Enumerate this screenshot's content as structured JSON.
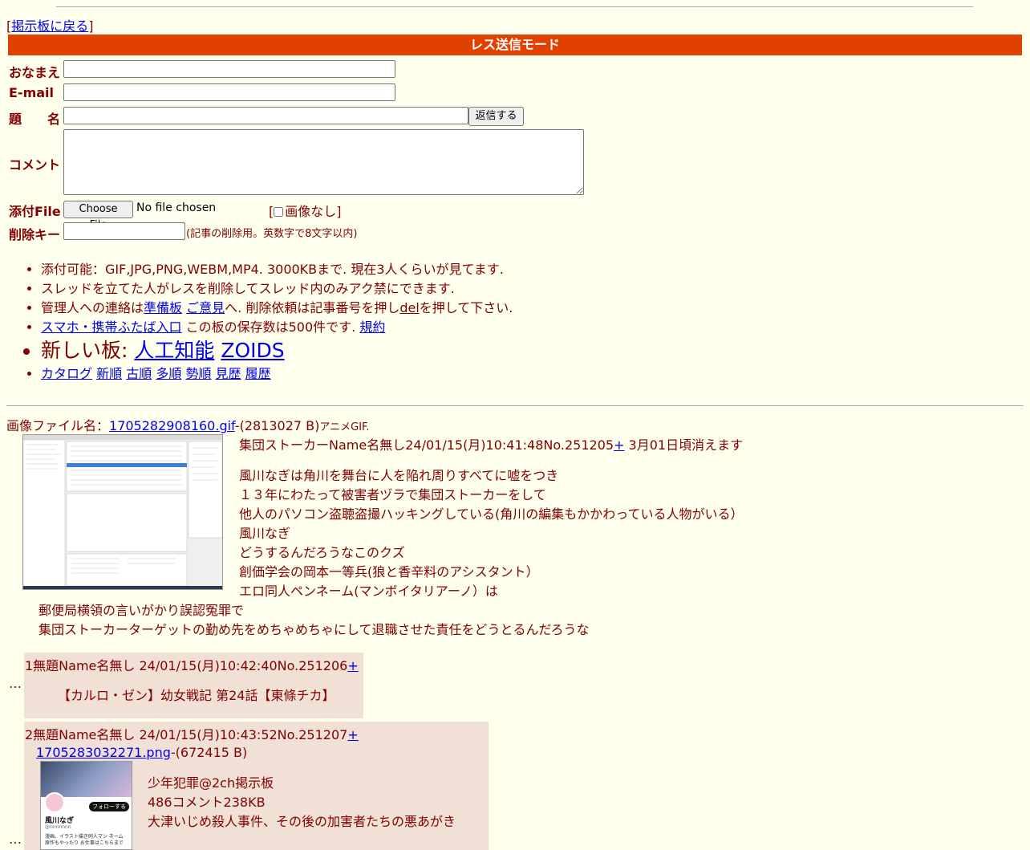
{
  "nav": {
    "back_link": "掲示板に戻る",
    "bracket_open": "[",
    "bracket_close": "]"
  },
  "form": {
    "mode_title": "レス送信モード",
    "name_label": "おなまえ",
    "email_label": "E-mail",
    "subject_label": "題　　名",
    "submit_label": "返信する",
    "comment_label": "コメント",
    "file_label": "添付File",
    "file_button": "Choose File",
    "file_status": "No file chosen",
    "noimage_label": "画像なし]",
    "noimage_open": "[",
    "delkey_label": "削除キー",
    "delkey_note": "(記事の削除用。英数字で8文字以内)"
  },
  "notes": {
    "line1": "添付可能：GIF,JPG,PNG,WEBM,MP4. 3000KBまで. 現在3人くらいが見てます.",
    "line2": "スレッドを立てた人がレスを削除してスレッド内のみアク禁にできます.",
    "line3_a": "管理人への連絡は",
    "line3_link1": "準備板",
    "line3_link2": "ご意見",
    "line3_b": "へ. 削除依頼は記事番号を押し",
    "line3_link3": "del",
    "line3_c": "を押して下さい.",
    "line4_link": "スマホ・携帯ふたば入口",
    "line4_text": " この板の保存数は500件です. ",
    "line4_link2": "規約",
    "line5_prefix": "新しい板: ",
    "line5_link1": "人工知能",
    "line5_link2": "ZOIDS",
    "line6_links": [
      "カタログ",
      "新順",
      "古順",
      "多順",
      "勢順",
      "見歴",
      "履歴"
    ]
  },
  "op": {
    "file_prefix": "画像ファイル名：",
    "file_name": "1705282908160.gif",
    "file_size": "-(2813027 B)",
    "file_type": "アニメGIF.",
    "header": "集団ストーカーName名無し24/01/15(月)10:41:48No.251205",
    "plus": "+",
    "expire": " 3月01日頃消えます",
    "body": [
      "風川なぎは角川を舞台に人を陥れ周りすべてに嘘をつき",
      "１３年にわたって被害者ヅラで集団ストーカーをして",
      "他人のパソコン盗聴盗撮ハッキングしている(角川の編集もかかわっている人物がいる）",
      "風川なぎ",
      "どうするんだろうなこのクズ",
      "創価学会の岡本一等兵(狼と香辛料のアシスタント）",
      "エロ同人ペンネーム(マンボイタリアーノ）は"
    ],
    "body2": [
      "郵便局横領の言いがかり誤認冤罪で",
      "集団ストーカーターゲットの勤め先をめちゃめちゃにして退職させた責任をどうとるんだろうな"
    ]
  },
  "replies": [
    {
      "dots": "…",
      "header": "1無題Name名無し 24/01/15(月)10:42:40No.251206",
      "plus": "+",
      "body": [
        "【カルロ・ゼン】幼女戦記 第24話【東條チカ】"
      ]
    },
    {
      "dots": "…",
      "header": "2無題Name名無し 24/01/15(月)10:43:52No.251207",
      "plus": "+",
      "file_name": "1705283032271.png",
      "file_size": "-(672415 B)",
      "body": [
        "少年犯罪@2ch掲示板",
        "486コメント238KB",
        "大津いじめ殺人事件、その後の加害者たちの悪あがき"
      ],
      "thumb_text": {
        "follow": "フォローする",
        "name": "風川なぎ",
        "handle": "@nnnnnnn",
        "bio1": "漫画、イラスト描き同人マン ネーム",
        "bio2": "原作もやったり お仕事はこちらまで"
      }
    }
  ],
  "colors": {
    "background": "#ffffee",
    "text": "#800000",
    "mode_bar": "#e04000",
    "reply_bg": "#f0e0d6",
    "link": "#0000ee"
  }
}
